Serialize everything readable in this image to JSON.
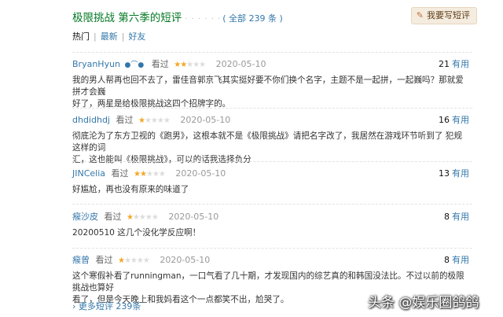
{
  "header": {
    "title": "极限挑战 第六季的短评",
    "dots": "· · · · · ·",
    "count_prefix": "( 全部 ",
    "count": "239",
    "count_suffix": " 条 )",
    "write_label": "我要写短评",
    "write_icon": "pencil-icon"
  },
  "tabs": [
    {
      "label": "热门",
      "active": true
    },
    {
      "label": "最新",
      "active": false
    },
    {
      "label": "好友",
      "active": false
    }
  ],
  "tab_separator": "|",
  "reviews": [
    {
      "user": "BryanHyun",
      "badge": "●⌒●",
      "label": "看过",
      "rating": 2,
      "date": "2020-05-10",
      "useful_count": "21",
      "useful_label": "有用",
      "lines": [
        "我的男人帮再也回不去了，雷佳音郭京飞其实挺好要不你们换个名字，主题不是一起拼，一起巍吗？那就爱拼才会巍",
        "好了，两星是给极限挑战这四个招牌字的。"
      ]
    },
    {
      "user": "dhdidhdj",
      "badge": "",
      "label": "看过",
      "rating": 1,
      "date": "2020-05-10",
      "useful_count": "16",
      "useful_label": "有用",
      "lines": [
        "彻底沦为了东方卫视的《跑男》，这根本就不是《极限挑战》请把名字改了，我居然在游戏环节听到了 犯规 这样的词",
        "汇，这也能叫《极限挑战》，可以的话我选择负分"
      ]
    },
    {
      "user": "JINCelia",
      "badge": "",
      "label": "看过",
      "rating": 2,
      "date": "2020-05-10",
      "useful_count": "13",
      "useful_label": "有用",
      "lines": [
        "好尴尬，再也没有原来的味道了"
      ]
    },
    {
      "user": "瘊沙皮",
      "badge": "",
      "label": "看过",
      "rating": 1,
      "date": "2020-05-10",
      "useful_count": "8",
      "useful_label": "有用",
      "lines": [
        "20200510 这几个没化学反应啊！"
      ]
    },
    {
      "user": "瘊曾",
      "badge": "",
      "label": "看过",
      "rating": 1,
      "date": "2020-05-10",
      "useful_count": "8",
      "useful_label": "有用",
      "lines": [
        "这个寒假补看了runningman，一口气看了几十期，才发现国内的综艺真的和韩国没法比。不过以前的极限挑战也算好",
        "看了，但是今天晚上和我妈看这个一点都笑不出，尬哭了。"
      ]
    }
  ],
  "more": {
    "arrow": "›",
    "label": "更多短评",
    "count": "239条"
  },
  "watermark": "头条 @娱乐圈鸽鸽",
  "colors": {
    "link": "#3377aa",
    "title_green": "#007722",
    "star": "#f5a623",
    "button_bg": "#f5ece0"
  }
}
